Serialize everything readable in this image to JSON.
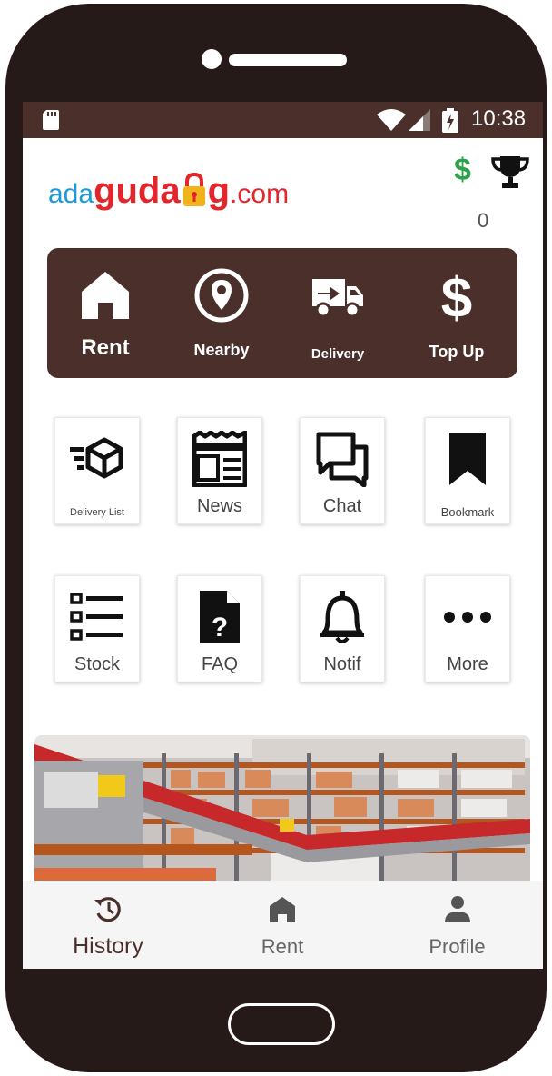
{
  "status_bar": {
    "time": "10:38"
  },
  "logo": {
    "part1": "ada",
    "part2": "guda",
    "part3": "g",
    "part4": ".com"
  },
  "wallet": {
    "points": "0"
  },
  "main_menu": [
    {
      "label": "Rent",
      "icon": "home-icon"
    },
    {
      "label": "Nearby",
      "icon": "location-pin-icon"
    },
    {
      "label": "Delivery",
      "icon": "truck-icon"
    },
    {
      "label": "Top Up",
      "icon": "dollar-icon"
    }
  ],
  "grid": [
    {
      "label": "Delivery List",
      "icon": "delivery-box-icon"
    },
    {
      "label": "News",
      "icon": "newspaper-icon"
    },
    {
      "label": "Chat",
      "icon": "chat-icon"
    },
    {
      "label": "Bookmark",
      "icon": "bookmark-icon"
    },
    {
      "label": "Stock",
      "icon": "list-icon"
    },
    {
      "label": "FAQ",
      "icon": "faq-document-icon"
    },
    {
      "label": "Notif",
      "icon": "bell-icon"
    },
    {
      "label": "More",
      "icon": "more-icon"
    }
  ],
  "bottom_nav": [
    {
      "label": "History",
      "icon": "history-icon",
      "active": true
    },
    {
      "label": "Rent",
      "icon": "home-icon",
      "active": false
    },
    {
      "label": "Profile",
      "icon": "person-icon",
      "active": false
    }
  ],
  "colors": {
    "brand_brown": "#4a2f2b",
    "logo_blue": "#1e9ad8",
    "logo_red": "#e3262c",
    "dollar_green": "#2ea24a"
  }
}
